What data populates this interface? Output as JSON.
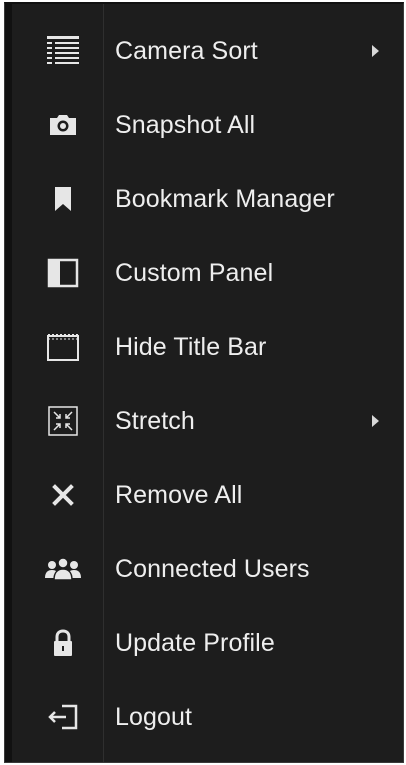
{
  "menu": {
    "items": [
      {
        "label": "Camera Sort",
        "icon": "list-icon",
        "submenu": true
      },
      {
        "label": "Snapshot All",
        "icon": "camera-icon",
        "submenu": false
      },
      {
        "label": "Bookmark Manager",
        "icon": "bookmark-icon",
        "submenu": false
      },
      {
        "label": "Custom Panel",
        "icon": "panel-icon",
        "submenu": false
      },
      {
        "label": "Hide Title Bar",
        "icon": "title-bar-icon",
        "submenu": false
      },
      {
        "label": "Stretch",
        "icon": "stretch-icon",
        "submenu": true
      },
      {
        "label": "Remove All",
        "icon": "close-icon",
        "submenu": false
      },
      {
        "label": "Connected Users",
        "icon": "users-icon",
        "submenu": false
      },
      {
        "label": "Update Profile",
        "icon": "lock-icon",
        "submenu": false
      },
      {
        "label": "Logout",
        "icon": "logout-icon",
        "submenu": false
      }
    ]
  },
  "colors": {
    "background": "#1d1d1d",
    "text": "#eeeeee",
    "icon": "#e6e6e6"
  }
}
